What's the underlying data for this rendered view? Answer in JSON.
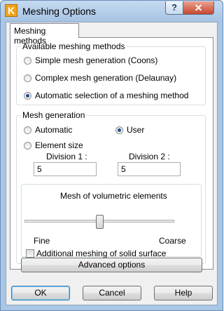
{
  "window": {
    "title": "Meshing Options",
    "help_button": "?",
    "close_button": "✕",
    "app_icon_letter": "K"
  },
  "tabs": [
    {
      "label": "Meshing methods"
    }
  ],
  "available_methods": {
    "legend": "Available meshing methods",
    "options": [
      {
        "label": "Simple mesh generation (Coons)",
        "selected": false
      },
      {
        "label": "Complex mesh generation (Delaunay)",
        "selected": false
      },
      {
        "label": "Automatic selection of a meshing method",
        "selected": true
      }
    ]
  },
  "mesh_generation": {
    "legend": "Mesh generation",
    "automatic_label": "Automatic",
    "user_label": "User",
    "element_size_label": "Element size",
    "selected": "User",
    "division1": {
      "label": "Division 1 :",
      "value": "5"
    },
    "division2": {
      "label": "Division 2 :",
      "value": "5"
    }
  },
  "volumetric": {
    "title": "Mesh of volumetric elements",
    "fine_label": "Fine",
    "coarse_label": "Coarse",
    "slider_level": 0.5,
    "additional_label": "Additional meshing of solid surface",
    "additional_checked": false
  },
  "buttons": {
    "advanced": "Advanced options",
    "ok": "OK",
    "cancel": "Cancel",
    "help": "Help"
  },
  "colors": {
    "accent": "#1f4c8f",
    "title_bar": "#a9c6e6"
  }
}
